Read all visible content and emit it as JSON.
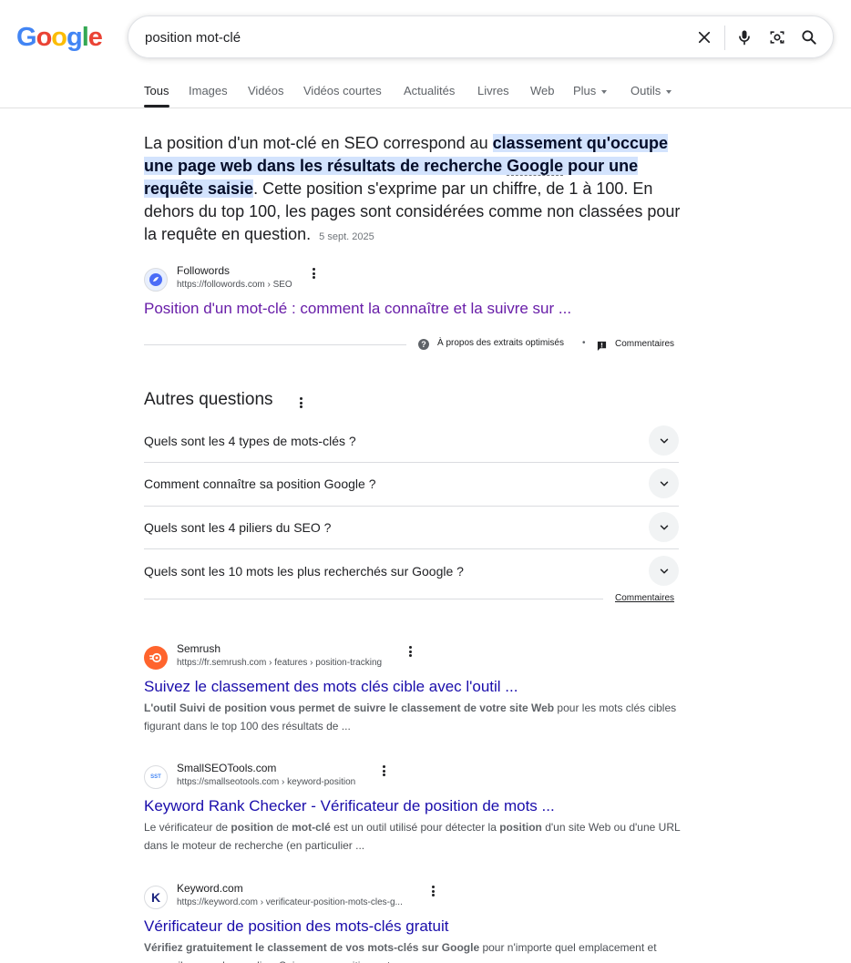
{
  "logo": [
    "G",
    "o",
    "o",
    "g",
    "l",
    "e"
  ],
  "search": {
    "query": "position mot-clé"
  },
  "tabs": [
    {
      "label": "Tous"
    },
    {
      "label": "Images"
    },
    {
      "label": "Vidéos"
    },
    {
      "label": "Vidéos courtes"
    },
    {
      "label": "Actualités"
    },
    {
      "label": "Livres"
    },
    {
      "label": "Web"
    },
    {
      "label": "Plus"
    },
    {
      "label": "Outils"
    }
  ],
  "featured": {
    "text_1": "La position d'un mot-clé en SEO correspond au ",
    "highlight_1": "classement qu'occupe une page web dans les résultats de recherche ",
    "highlight_link": "Google",
    "highlight_2": " pour une requête saisie",
    "text_2": ". Cette position s'exprime par un chiffre, de 1 à 100. En dehors du top 100, les pages sont considérées comme non classées pour la requête en question.",
    "date": "5 sept. 2025",
    "source_name": "Followords",
    "source_url": "https://followords.com › SEO",
    "title": "Position d'un mot-clé : comment la connaître et la suivre sur ...",
    "about_label": "À propos des extraits optimisés",
    "bullet": "•",
    "feedback_label": "Commentaires"
  },
  "paa": {
    "title": "Autres questions",
    "questions": [
      "Quels sont les 4 types de mots-clés ?",
      "Comment connaître sa position Google ?",
      "Quels sont les 4 piliers du SEO ?",
      "Quels sont les 10 mots les plus recherchés sur Google ?"
    ],
    "feedback_label": "Commentaires"
  },
  "results": [
    {
      "name": "Semrush",
      "url": "https://fr.semrush.com › features › position-tracking",
      "title": "Suivez le classement des mots clés cible avec l'outil ...",
      "desc_parts": [
        {
          "b": "L'outil Suivi de position vous permet de suivre le classement de votre site Web"
        },
        {
          "t": " pour les mots clés cibles figurant dans le top 100 des résultats de ..."
        }
      ]
    },
    {
      "name": "SmallSEOTools.com",
      "url": "https://smallseotools.com › keyword-position",
      "title": "Keyword Rank Checker - Vérificateur de position de mots ...",
      "desc_parts": [
        {
          "t": "Le vérificateur de "
        },
        {
          "b": "position"
        },
        {
          "t": " de "
        },
        {
          "b": "mot-clé"
        },
        {
          "t": " est un outil utilisé pour détecter la "
        },
        {
          "b": "position"
        },
        {
          "t": " d'un site Web ou d'une URL dans le moteur de recherche (en particulier ..."
        }
      ],
      "fav_text": "SST"
    },
    {
      "name": "Keyword.com",
      "url": "https://keyword.com › verificateur-position-mots-cles-g...",
      "title": "Vérificateur de position des mots-clés gratuit",
      "desc_parts": [
        {
          "b": "Vérifiez gratuitement le classement de vos mots-clés sur Google"
        },
        {
          "t": " pour n'importe quel emplacement et appareil, en quelques clics. Suivez vos positions et ..."
        }
      ],
      "fav_text": "K"
    }
  ]
}
